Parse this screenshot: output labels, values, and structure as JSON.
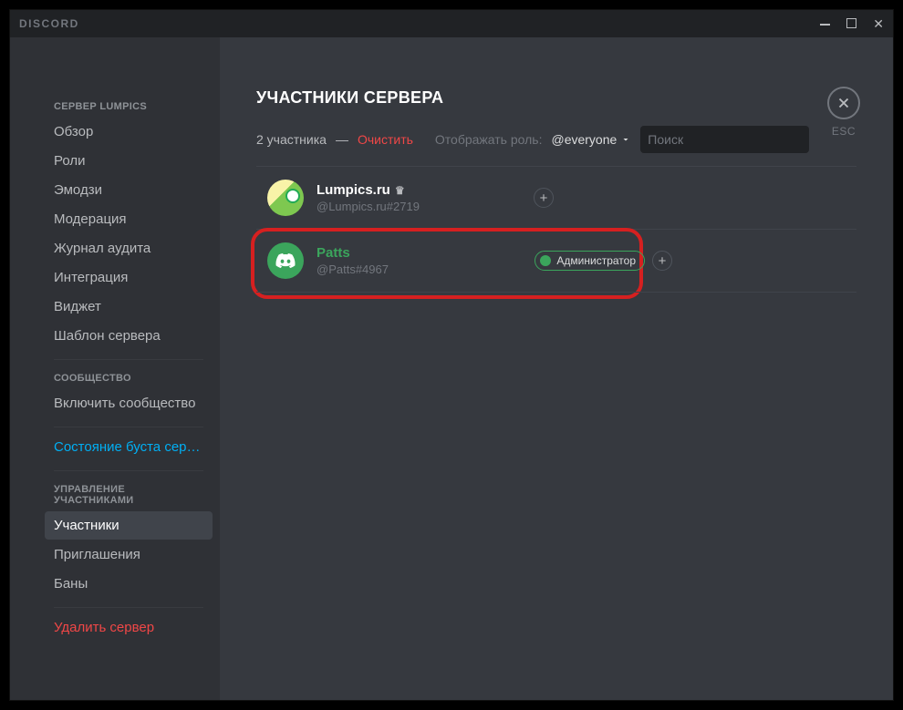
{
  "titlebar": {
    "brand": "DISCORD"
  },
  "sidebar": {
    "heading_server": "СЕРВЕР LUMPICS",
    "items_server": [
      "Обзор",
      "Роли",
      "Эмодзи",
      "Модерация",
      "Журнал аудита",
      "Интеграция",
      "Виджет",
      "Шаблон сервера"
    ],
    "heading_community": "СООБЩЕСТВО",
    "item_enable_community": "Включить сообщество",
    "item_boost_status": "Состояние буста серв...",
    "heading_user_mgmt": "УПРАВЛЕНИЕ УЧАСТНИКАМИ",
    "items_user_mgmt": [
      "Участники",
      "Приглашения",
      "Баны"
    ],
    "item_delete_server": "Удалить сервер"
  },
  "content": {
    "page_title": "УЧАСТНИКИ СЕРВЕРА",
    "member_count_text": "2 участника",
    "clear_text": "Очистить",
    "role_filter_label": "Отображать роль:",
    "role_filter_value": "@everyone",
    "search_placeholder": "Поиск",
    "esc_label": "ESC",
    "members": [
      {
        "name": "Lumpics.ru",
        "tag": "@Lumpics.ru#2719",
        "is_owner": true,
        "avatar_kind": "yoshi",
        "roles": []
      },
      {
        "name": "Patts",
        "tag": "@Patts#4967",
        "is_owner": false,
        "avatar_kind": "discord",
        "roles": [
          "Администратор"
        ]
      }
    ]
  }
}
